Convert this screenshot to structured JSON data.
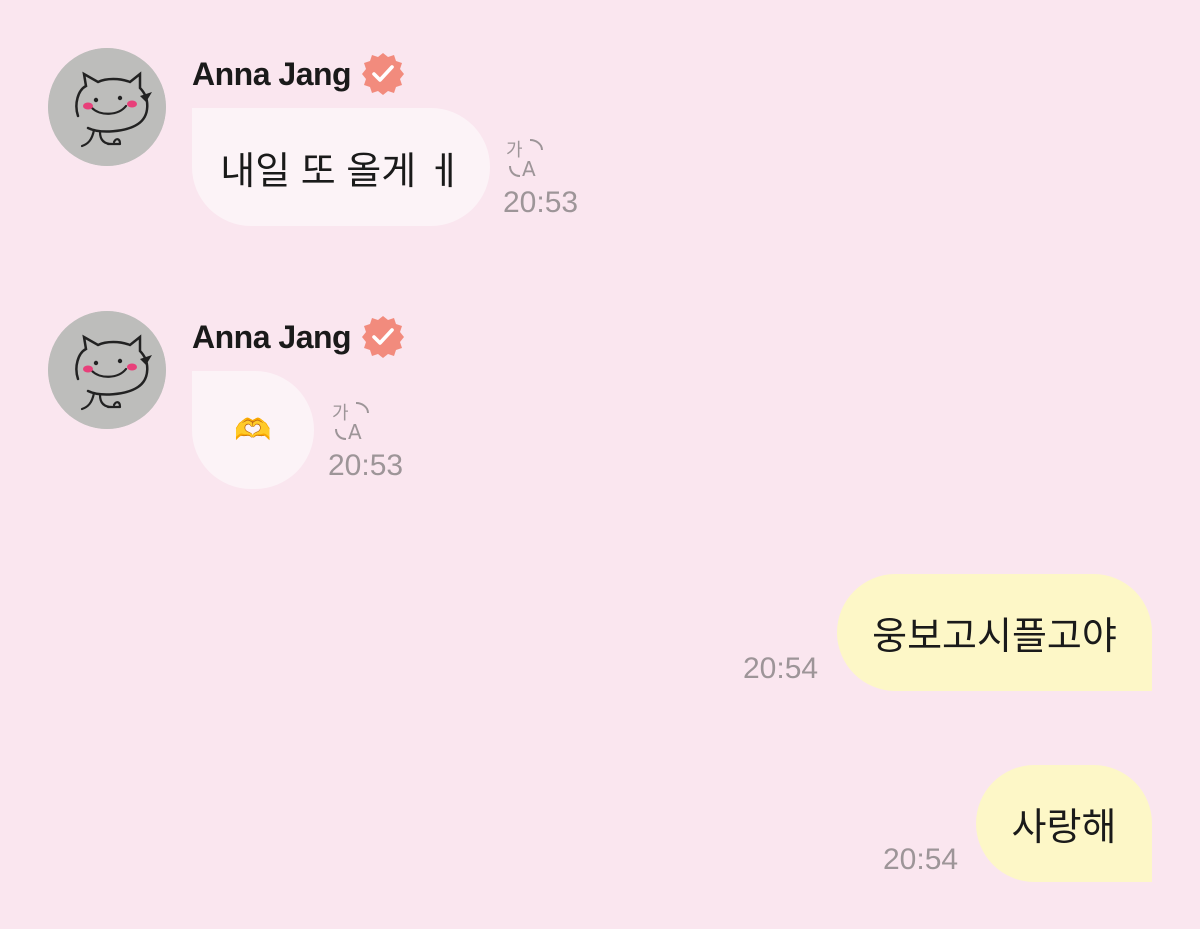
{
  "messages": [
    {
      "direction": "incoming",
      "sender": "Anna Jang",
      "verified": true,
      "text": "내일 또 올게 ㅔ",
      "time": "20:53",
      "translate_icon": "translate-icon"
    },
    {
      "direction": "incoming",
      "sender": "Anna Jang",
      "verified": true,
      "text": "🫶",
      "time": "20:53",
      "translate_icon": "translate-icon"
    },
    {
      "direction": "outgoing",
      "text": "웅보고시플고야",
      "time": "20:54"
    },
    {
      "direction": "outgoing",
      "text": "사랑해",
      "time": "20:54"
    }
  ],
  "colors": {
    "background": "#fae6ef",
    "incoming_bubble": "#fcf3f7",
    "outgoing_bubble": "#fdf7c7",
    "verified_badge": "#f28b7d",
    "timestamp": "#9d9598"
  }
}
